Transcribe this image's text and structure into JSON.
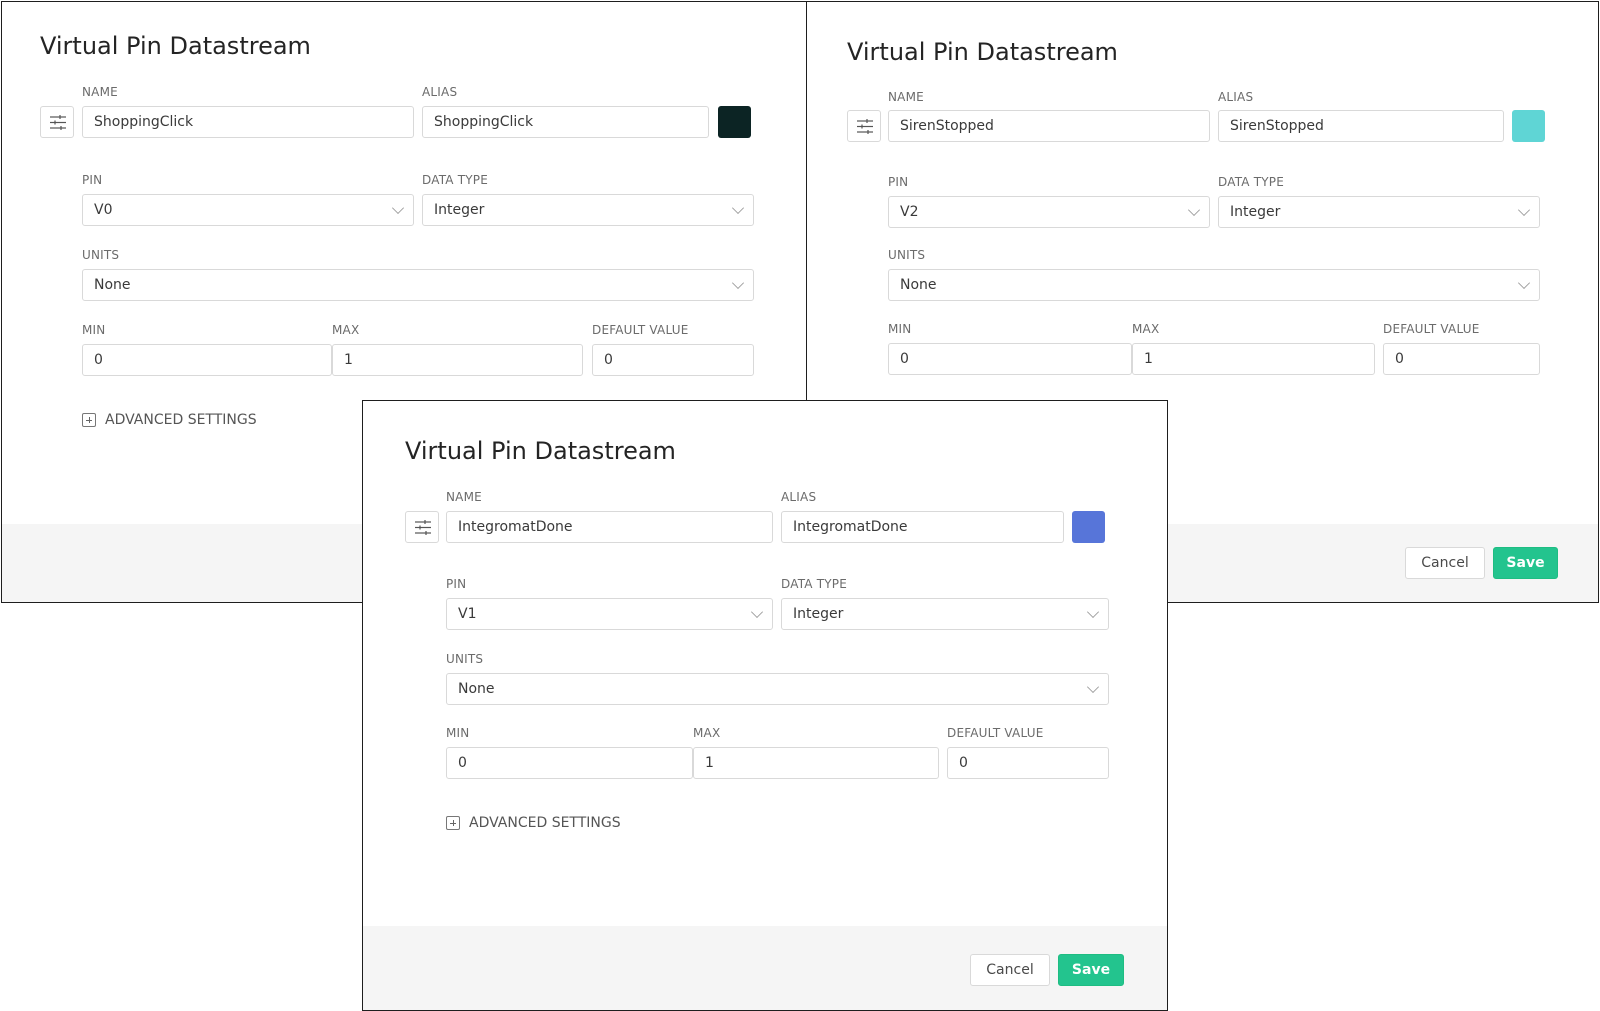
{
  "colors": {
    "save_button": "#23c48e",
    "footer_bg": "#f5f5f5",
    "border": "#d9d9d9"
  },
  "icons": {
    "settings": "sliders-icon",
    "advanced": "plus-square-icon",
    "select": "chevron-down-icon"
  },
  "dialogs": [
    {
      "title": "Virtual Pin Datastream",
      "name_label": "NAME",
      "name_value": "ShoppingClick",
      "alias_label": "ALIAS",
      "alias_value": "ShoppingClick",
      "color": "#0c2424",
      "pin_label": "PIN",
      "pin_value": "V0",
      "datatype_label": "DATA TYPE",
      "datatype_value": "Integer",
      "units_label": "UNITS",
      "units_value": "None",
      "min_label": "MIN",
      "min_value": "0",
      "max_label": "MAX",
      "max_value": "1",
      "default_label": "DEFAULT VALUE",
      "default_value": "0",
      "advanced_label": "ADVANCED SETTINGS"
    },
    {
      "title": "Virtual Pin Datastream",
      "name_label": "NAME",
      "name_value": "SirenStopped",
      "alias_label": "ALIAS",
      "alias_value": "SirenStopped",
      "color": "#5fd5d5",
      "pin_label": "PIN",
      "pin_value": "V2",
      "datatype_label": "DATA TYPE",
      "datatype_value": "Integer",
      "units_label": "UNITS",
      "units_value": "None",
      "min_label": "MIN",
      "min_value": "0",
      "max_label": "MAX",
      "max_value": "1",
      "default_label": "DEFAULT VALUE",
      "default_value": "0",
      "cancel_label": "Cancel",
      "save_label": "Save"
    },
    {
      "title": "Virtual Pin Datastream",
      "name_label": "NAME",
      "name_value": "IntegromatDone",
      "alias_label": "ALIAS",
      "alias_value": "IntegromatDone",
      "color": "#5775d9",
      "pin_label": "PIN",
      "pin_value": "V1",
      "datatype_label": "DATA TYPE",
      "datatype_value": "Integer",
      "units_label": "UNITS",
      "units_value": "None",
      "min_label": "MIN",
      "min_value": "0",
      "max_label": "MAX",
      "max_value": "1",
      "default_label": "DEFAULT VALUE",
      "default_value": "0",
      "advanced_label": "ADVANCED SETTINGS",
      "cancel_label": "Cancel",
      "save_label": "Save"
    }
  ]
}
